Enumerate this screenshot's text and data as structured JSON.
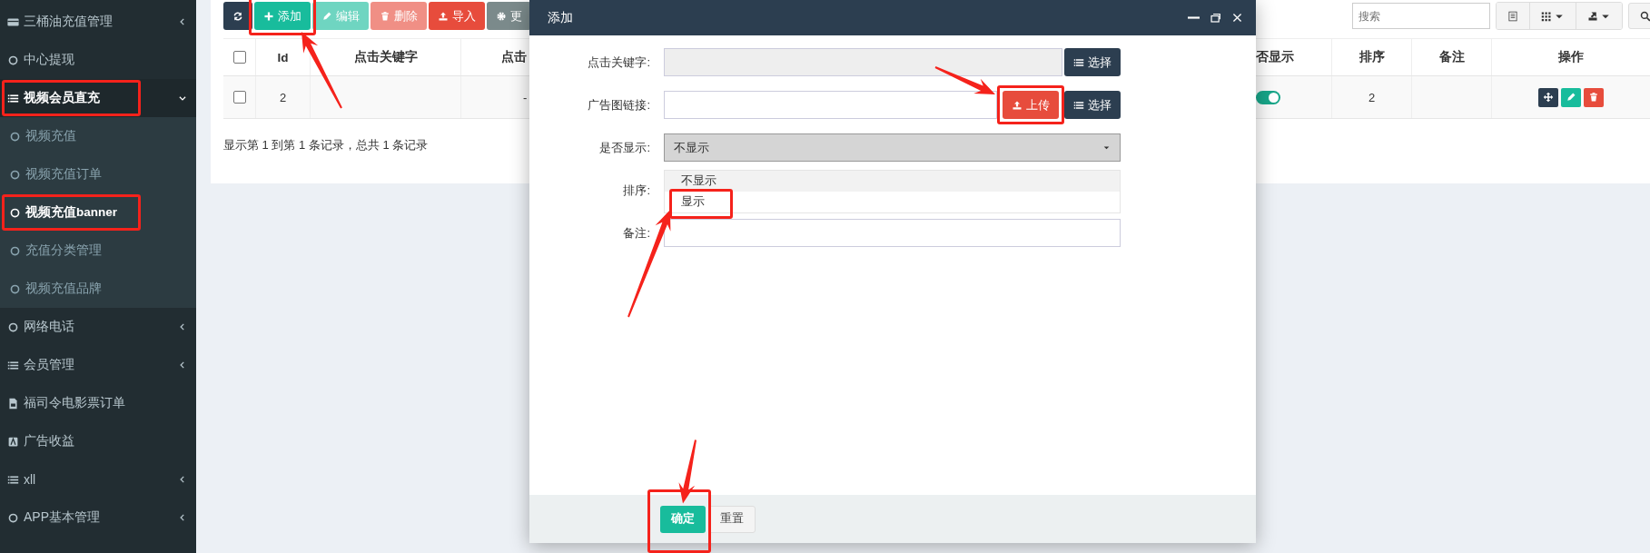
{
  "sidebar": {
    "items": [
      {
        "label": "三桶油充值管理",
        "expanded": false,
        "highlighted": false
      },
      {
        "label": "中心提现",
        "highlighted": false
      },
      {
        "label": "视频会员直充",
        "expanded": true,
        "highlighted": true,
        "children": [
          {
            "label": "视频充值",
            "selected": false,
            "highlighted": false
          },
          {
            "label": "视频充值订单",
            "selected": false,
            "highlighted": false
          },
          {
            "label": "视频充值banner",
            "selected": true,
            "highlighted": true
          },
          {
            "label": "充值分类管理",
            "selected": false,
            "highlighted": false
          },
          {
            "label": "视频充值品牌",
            "selected": false,
            "highlighted": false
          }
        ]
      },
      {
        "label": "网络电话",
        "expanded": false,
        "highlighted": false
      },
      {
        "label": "会员管理",
        "expanded": false,
        "highlighted": false
      },
      {
        "label": "福司令电影票订单",
        "highlighted": false
      },
      {
        "label": "广告收益",
        "highlighted": false
      },
      {
        "label": "xll",
        "expanded": false,
        "highlighted": false
      },
      {
        "label": "APP基本管理",
        "expanded": false,
        "highlighted": false
      }
    ]
  },
  "toolbar": {
    "buttons": [
      {
        "kind": "dark",
        "disabled": false,
        "highlighted": false,
        "arrow": false
      },
      {
        "label": "添加",
        "kind": "success",
        "disabled": false,
        "highlighted": true,
        "arrow": true
      },
      {
        "label": "编辑",
        "kind": "success",
        "disabled": true,
        "highlighted": false,
        "arrow": false
      },
      {
        "label": "删除",
        "kind": "danger",
        "disabled": true,
        "highlighted": false,
        "arrow": false
      },
      {
        "label": "导入",
        "kind": "danger",
        "disabled": false,
        "highlighted": false,
        "arrow": false
      },
      {
        "label": "更",
        "kind": "gray",
        "disabled": false,
        "highlighted": false,
        "arrow": false
      }
    ],
    "search": {
      "placeholder": "搜索"
    }
  },
  "table": {
    "columns": [
      {
        "kind": "checkbox",
        "checked": false
      },
      {
        "label": "Id"
      },
      {
        "label": "点击关键字"
      },
      {
        "label": "点击"
      },
      {
        "label": "否显示"
      },
      {
        "label": "排序"
      },
      {
        "label": "备注"
      },
      {
        "label": "操作"
      }
    ],
    "rows": [
      {
        "checked": false,
        "id": "2",
        "column_4": "-",
        "shown": true,
        "order": "2"
      }
    ]
  },
  "pagination_text": "显示第 1 到第 1 条记录，总共 1 条记录",
  "modal": {
    "title": "添加",
    "fields": [
      {
        "label": "点击关键字:",
        "kind": "input",
        "readonly": true,
        "buttons": [
          {
            "label": "选择",
            "kind": "dark",
            "highlighted": false,
            "arrow": false
          }
        ]
      },
      {
        "label": "广告图链接:",
        "kind": "input",
        "readonly": false,
        "buttons": [
          {
            "label": "上传",
            "kind": "danger",
            "highlighted": true,
            "arrow": true
          },
          {
            "label": "选择",
            "kind": "dark",
            "highlighted": false,
            "arrow": false
          }
        ]
      },
      {
        "label": "是否显示:",
        "kind": "select",
        "value": "不显示",
        "open": true,
        "options": [
          {
            "label": "不显示",
            "selected": true,
            "highlighted": false,
            "arrow": false
          },
          {
            "label": "显示",
            "selected": false,
            "highlighted": true,
            "arrow": true
          }
        ]
      },
      {
        "label": "排序:",
        "kind": "covered"
      },
      {
        "label": "备注:",
        "kind": "input",
        "readonly": false
      }
    ],
    "buttons": [
      {
        "label": "确定",
        "kind": "success",
        "highlighted": true,
        "arrow": true
      },
      {
        "label": "重置",
        "kind": "default",
        "highlighted": false,
        "arrow": false
      }
    ]
  }
}
